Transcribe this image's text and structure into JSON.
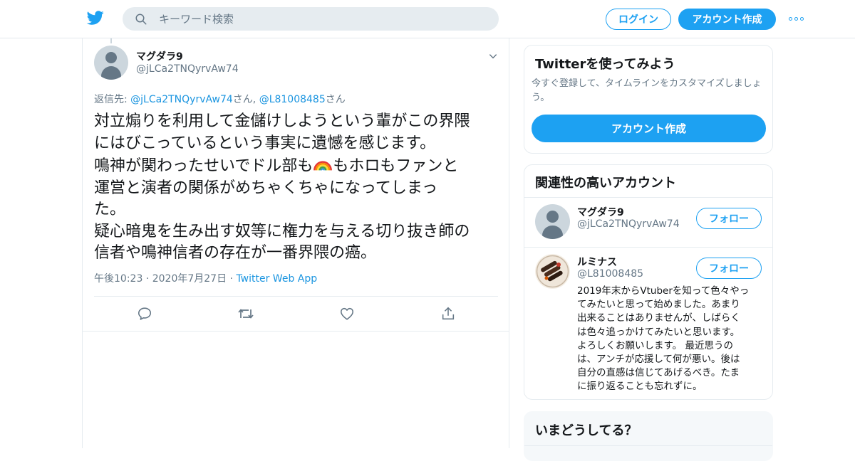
{
  "header": {
    "search_placeholder": "キーワード検索",
    "login_label": "ログイン",
    "signup_label": "アカウント作成"
  },
  "tweet": {
    "author_name": "マグダラ9",
    "author_handle": "@jLCa2TNQyrvAw74",
    "reply_prefix": "返信先: ",
    "reply_user1": "@jLCa2TNQyrvAw74",
    "reply_san1": "さん, ",
    "reply_user2": "@L81008485",
    "reply_san2": "さん",
    "lines": [
      "対立煽りを利用して金儲けしようという輩がこの界隈",
      "にはびこっているという事実に遺憾を感じます。",
      "鳴神が関わったせいでドル部も",
      "もホロもファンと",
      "運営と演者の関係がめちゃくちゃになってしまっ",
      "た。",
      "疑心暗鬼を生み出す奴等に権力を与える切り抜き師の",
      "信者や鳴神信者の存在が一番界隈の癌。"
    ],
    "time": "午後10:23",
    "date": "2020年7月27日",
    "source": "Twitter Web App"
  },
  "signup_card": {
    "title": "Twitterを使ってみよう",
    "description": "今すぐ登録して、タイムラインをカスタマイズしましょう。",
    "button_label": "アカウント作成"
  },
  "related_card": {
    "title": "関連性の高いアカウント",
    "accounts": [
      {
        "name": "マグダラ9",
        "handle": "@jLCa2TNQyrvAw74",
        "follow_label": "フォロー"
      },
      {
        "name": "ルミナス",
        "handle": "@L81008485",
        "follow_label": "フォロー",
        "bio_lines": [
          "2019年末からVtuberを知って色々やっ",
          "てみたいと思って始めました。あまり",
          "出来ることはありませんが、しばらく",
          "は色々追っかけてみたいと思います。",
          "よろしくお願いします。 最近思うの",
          "は、アンチが応援して何が悪い。後は",
          "自分の直感は信じてあげるべき。たま",
          "に振り返ることも忘れずに。"
        ]
      }
    ]
  },
  "trends_card": {
    "title": "いまどうしてる？"
  },
  "colors": {
    "accent": "#1da1f2",
    "link": "#1b95e0",
    "secondary_text": "#657786",
    "border": "#e6ecf0"
  }
}
